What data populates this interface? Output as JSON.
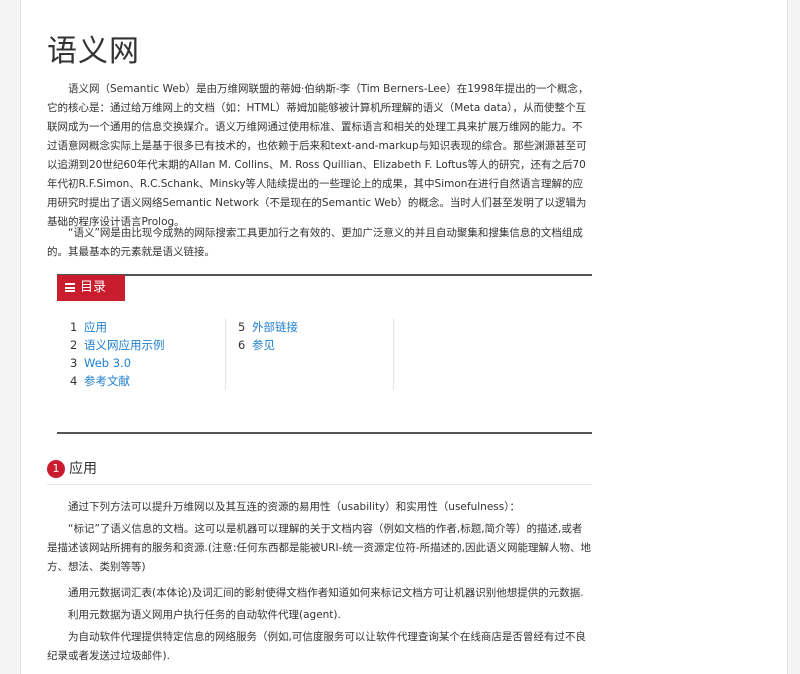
{
  "article": {
    "title": "语义网",
    "intro": [
      "语义网（Semantic Web）是由万维网联盟的蒂姆·伯纳斯-李（Tim Berners-Lee）在1998年提出的一个概念，它的核心是：通过给万维网上的文档（如：HTML）蒂姆加能够被计算机所理解的语义（Meta data），从而使整个互联网成为一个通用的信息交换媒介。语义万维网通过使用标准、置标语言和相关的处理工具来扩展万维网的能力。不过语意网概念实际上是基于很多已有技术的，也依赖于后来和text-and-markup与知识表现的综合。那些渊源甚至可以追溯到20世纪60年代末期的Allan M. Collins、M. Ross Quillian、Elizabeth F. Loftus等人的研究，还有之后70年代初R.F.Simon、R.C.Schank、Minsky等人陆续提出的一些理论上的成果，其中Simon在进行自然语言理解的应用研究时提出了语义网络Semantic Network（不是现在的Semantic Web）的概念。当时人们甚至发明了以逻辑为基础的程序设计语言Prolog。",
      "“语义”网是由比现今成熟的网际搜索工具更加行之有效的、更加广泛意义的并且自动聚集和搜集信息的文档组成的。其最基本的元素就是语义链接。"
    ]
  },
  "toc": {
    "label": "目录",
    "columns": [
      [
        {
          "num": "1",
          "label": "应用"
        },
        {
          "num": "2",
          "label": "语义网应用示例"
        },
        {
          "num": "3",
          "label": "Web 3.0"
        },
        {
          "num": "4",
          "label": "参考文献"
        }
      ],
      [
        {
          "num": "5",
          "label": "外部链接"
        },
        {
          "num": "6",
          "label": "参见"
        }
      ]
    ]
  },
  "section1": {
    "num": "1",
    "title": "应用",
    "paragraphs": [
      "通过下列方法可以提升万维网以及其互连的资源的易用性（usability）和实用性（usefulness）：",
      "“标记”了语义信息的文档。这可以是机器可以理解的关于文档内容（例如文档的作者,标题,简介等）的描述,或者是描述该网站所拥有的服务和资源.(注意:任何东西都是能被URI-统一资源定位符-所描述的,因此语义网能理解人物、地方、想法、类别等等)",
      "通用元数据词汇表(本体论)及词汇间的影射使得文档作者知道如何来标记文档方可让机器识别他想提供的元数据.",
      "利用元数据为语义网用户执行任务的自动软件代理(agent).",
      "为自动软件代理提供特定信息的网络服务（例如,可信度服务可以让软件代理查询某个在线商店是否曾经有过不良纪录或者发送过垃圾邮件)."
    ]
  },
  "colors": {
    "accent": "#c91d2e",
    "link": "#1f7fd0"
  }
}
